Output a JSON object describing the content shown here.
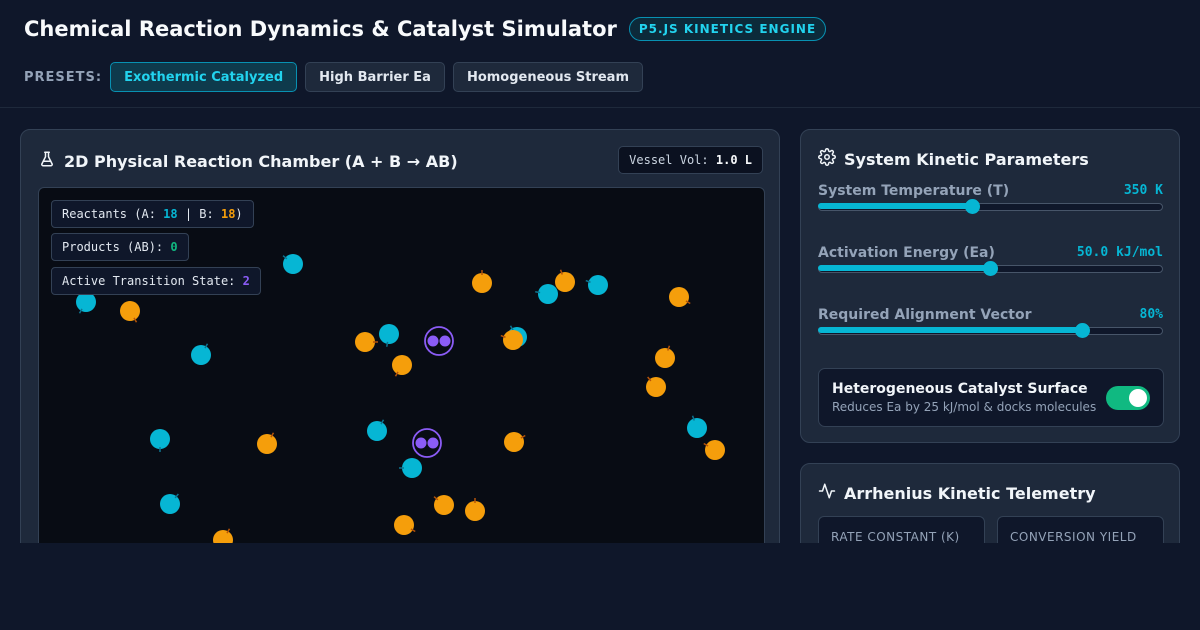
{
  "header": {
    "title": "Chemical Reaction Dynamics & Catalyst Simulator",
    "engine_badge": "P5.JS KINETICS ENGINE",
    "presets_label": "PRESETS:",
    "presets": [
      "Exothermic Catalyzed",
      "High Barrier Ea",
      "Homogeneous Stream"
    ],
    "active_preset": "Exothermic Catalyzed"
  },
  "chamber": {
    "title": "2D Physical Reaction Chamber (A + B → AB)",
    "vessel_label": "Vessel Vol:",
    "vessel_value": "1.0 L",
    "stats": {
      "reactants_prefix": "Reactants (A: ",
      "reactants_a": "18",
      "reactants_sep": " | B: ",
      "reactants_b": "18",
      "reactants_suffix": ")",
      "products_label": "Products (AB): ",
      "products": "0",
      "transition_label": "Active Transition State: ",
      "transition": "2"
    }
  },
  "params": {
    "title": "System Kinetic Parameters",
    "sliders": [
      {
        "label": "System Temperature (T)",
        "value": "350 K",
        "fraction": 0.45
      },
      {
        "label": "Activation Energy (Ea)",
        "value": "50.0 kJ/mol",
        "fraction": 0.5
      },
      {
        "label": "Required Alignment Vector",
        "value": "80%",
        "fraction": 0.77
      }
    ],
    "catalyst": {
      "title": "Heterogeneous Catalyst Surface",
      "desc": "Reduces Ea by 25 kJ/mol & docks molecules",
      "enabled": true
    }
  },
  "telemetry": {
    "title": "Arrhenius Kinetic Telemetry",
    "cards": [
      "RATE CONSTANT (K)",
      "CONVERSION YIELD"
    ]
  },
  "colors": {
    "reactant_a": "#06b6d4",
    "reactant_b": "#f59e0b",
    "transition": "#8b5cf6",
    "accent": "#22d3ee",
    "toggle_on": "#10b981"
  }
}
